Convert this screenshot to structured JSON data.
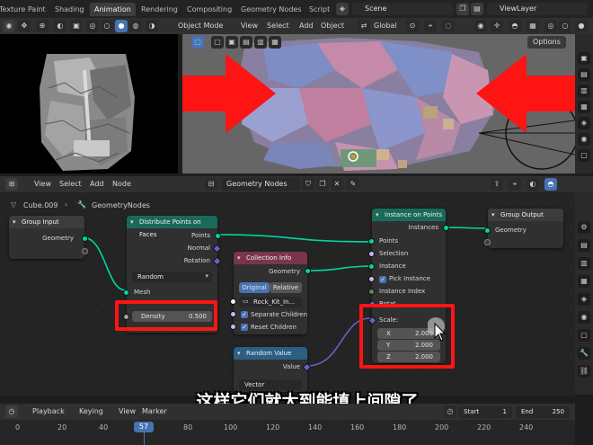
{
  "topbar": {
    "workspace_tabs": [
      "Texture Paint",
      "Shading",
      "Animation",
      "Rendering",
      "Compositing",
      "Geometry Nodes",
      "Script"
    ],
    "active_tab": "Animation",
    "scene": "Scene",
    "view_layer": "ViewLayer"
  },
  "viewport": {
    "options_label": "Options",
    "mode": "Object Mode",
    "menus": [
      "View",
      "Select",
      "Add",
      "Object"
    ],
    "transform": "Global"
  },
  "node_editor": {
    "menus": [
      "View",
      "Select",
      "Add",
      "Node"
    ],
    "tree_type": "Geometry Nodes",
    "breadcrumb_object": "Cube.009",
    "breadcrumb_tree": "GeometryNodes",
    "nodes": {
      "group_input": {
        "title": "Group Input",
        "geometry": "Geometry"
      },
      "distribute": {
        "title": "Distribute Points on Faces",
        "points": "Points",
        "normal": "Normal",
        "rotation": "Rotation",
        "mode": "Random",
        "mesh": "Mesh",
        "density_label": "Density",
        "density_value": "0.500"
      },
      "collection_info": {
        "title": "Collection Info",
        "geometry": "Geometry",
        "original": "Original",
        "relative": "Relative",
        "collection": "Rock_Kit_In...",
        "separate_children": "Separate Children",
        "reset_children": "Reset Children"
      },
      "instance_on_points": {
        "title": "Instance on Points",
        "instances": "Instances",
        "points": "Points",
        "selection": "Selection",
        "instance": "Instance",
        "pick_instance": "Pick Instance",
        "instance_index": "Instance Index",
        "rotation": "Rotat...",
        "scale": "Scale:",
        "x_label": "X",
        "x_value": "2.000",
        "y_label": "Y",
        "y_value": "2.000",
        "z_label": "Z",
        "z_value": "2.000"
      },
      "group_output": {
        "title": "Group Output",
        "geometry": "Geometry"
      },
      "random_value": {
        "title": "Random Value",
        "value": "Value",
        "type": "Vector"
      }
    }
  },
  "subtitle": "这样它们就太到能填上间隙了",
  "timeline": {
    "menus": [
      "Playback",
      "Keying",
      "View",
      "Marker"
    ],
    "current_frame": "57",
    "start_label": "Start",
    "start_value": "1",
    "end_label": "End",
    "end_value": "250",
    "ticks": [
      "0",
      "20",
      "40",
      "60",
      "80",
      "100",
      "120",
      "140",
      "160",
      "180",
      "200",
      "220",
      "240"
    ]
  },
  "colors": {
    "annotation_red": "#ff1414",
    "accent_blue": "#4772b3",
    "geometry_socket": "#00d6a3"
  }
}
